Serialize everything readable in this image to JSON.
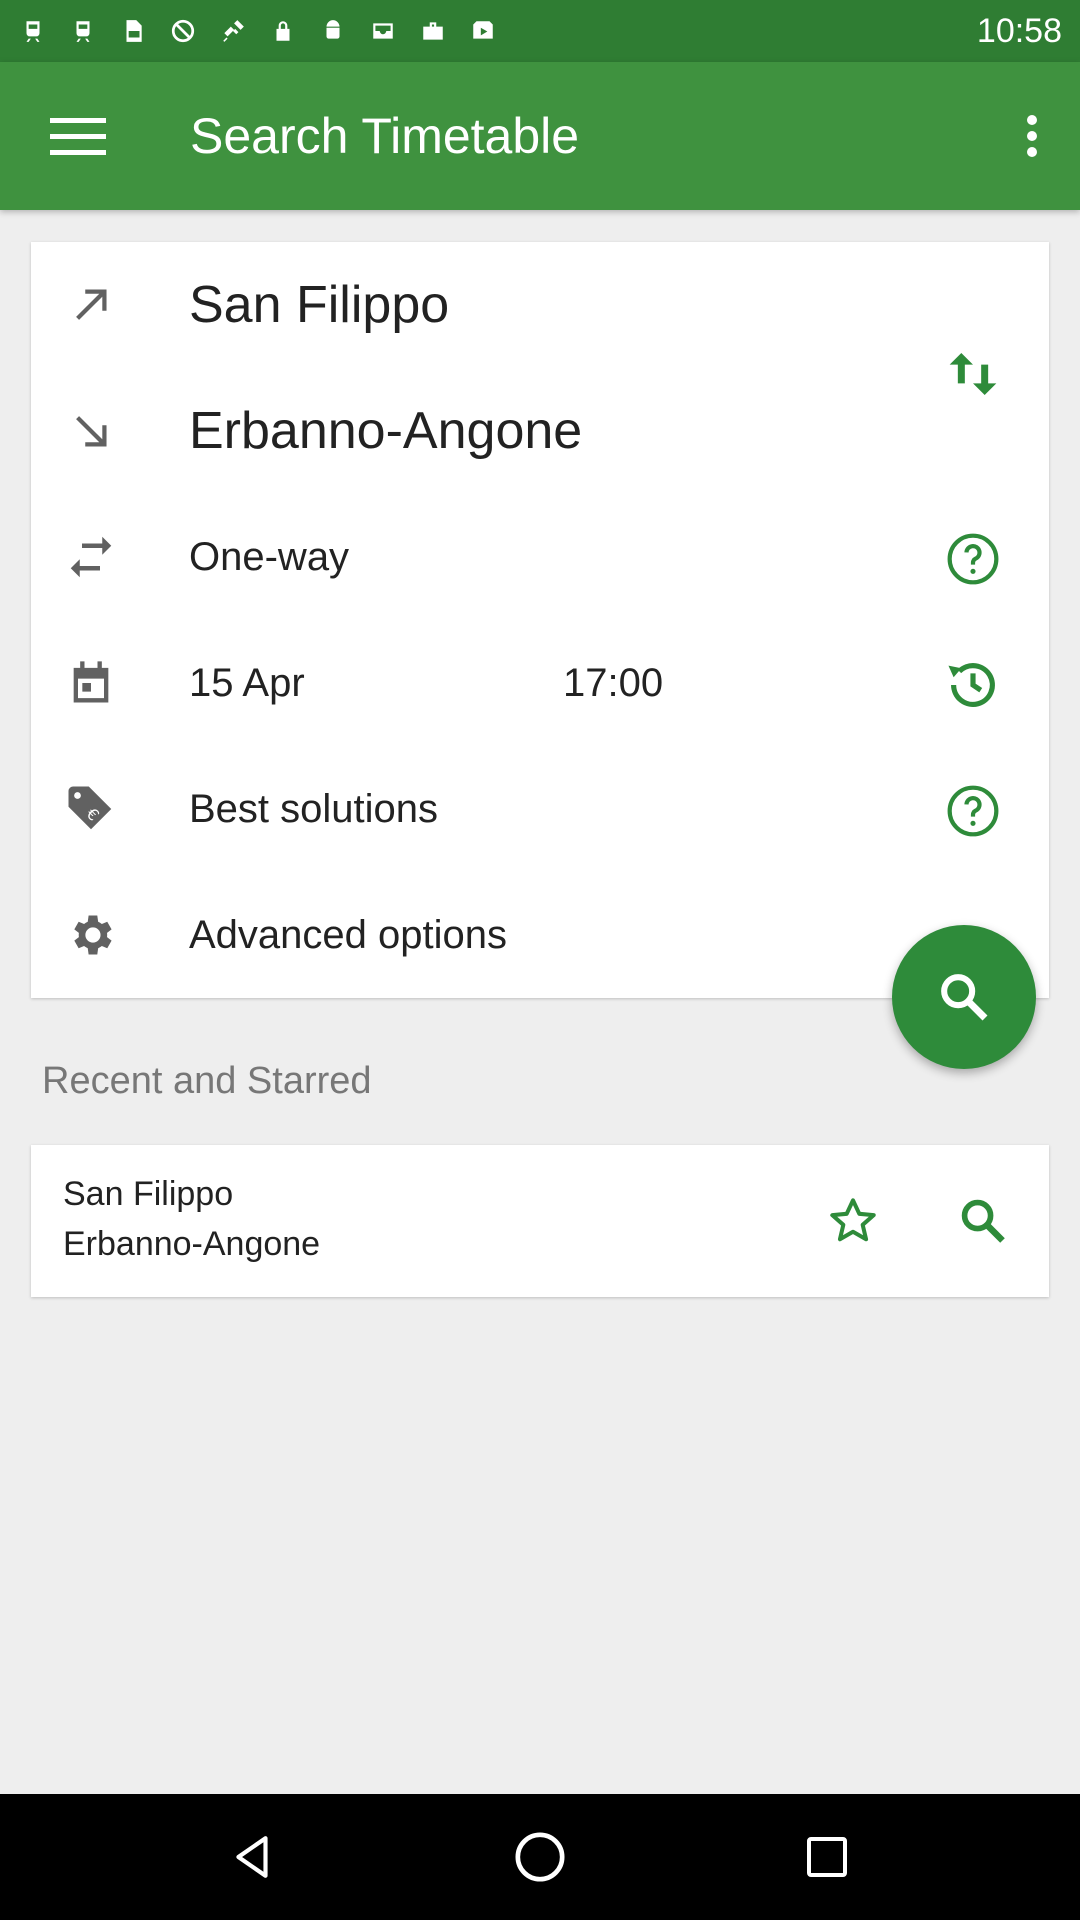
{
  "status_bar": {
    "time": "10:58",
    "icons": [
      "train-icon",
      "train-icon",
      "sim-icon",
      "no-sim-icon",
      "satellite-icon",
      "lock-icon",
      "android-icon",
      "inbox-check-icon",
      "briefcase-icon",
      "play-store-icon"
    ]
  },
  "app_bar": {
    "title": "Search Timetable",
    "menu_icon": "hamburger-menu-icon",
    "overflow_icon": "more-vert-icon"
  },
  "search_form": {
    "from": "San Filippo",
    "to": "Erbanno-Angone",
    "trip_type": "One-way",
    "date": "15 Apr",
    "time": "17:00",
    "solutions": "Best solutions",
    "advanced": "Advanced options"
  },
  "recent_section": {
    "title": "Recent and Starred",
    "items": [
      {
        "from": "San Filippo",
        "to": "Erbanno-Angone"
      }
    ]
  },
  "colors": {
    "status_bar": "#2f7d33",
    "app_bar": "#3f923f",
    "accent": "#2e8b3a",
    "icon_gray": "#616161"
  }
}
